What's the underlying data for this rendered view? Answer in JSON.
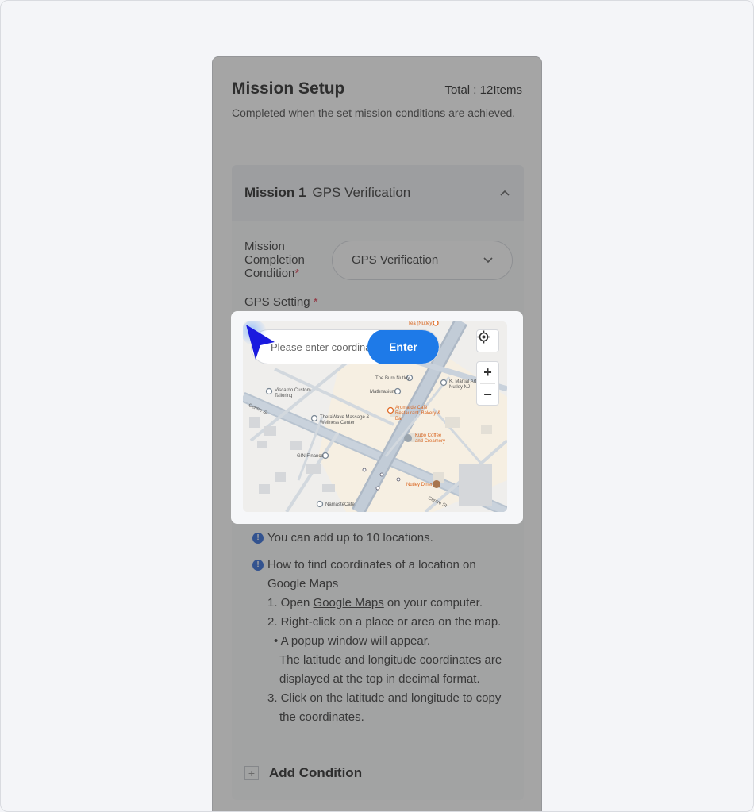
{
  "header": {
    "title": "Mission Setup",
    "total": "Total : 12Items",
    "subtitle": "Completed when the set mission conditions are achieved."
  },
  "mission": {
    "number": "Mission 1",
    "name": "GPS Verification",
    "condition_label": "Mission Completion Condition",
    "required_mark": "*",
    "condition_value": "GPS Verification",
    "gps_label": "GPS Setting"
  },
  "map": {
    "search_placeholder": "Please enter coordinates",
    "enter_label": "Enter",
    "zoom_in": "+",
    "zoom_out": "−",
    "places": {
      "tea": "Tea (Nutley)",
      "burn": "The Burn Nutley",
      "martial": "K. Martial Arts Nutley NJ",
      "mathnasium": "Mathnasium",
      "viscardo": "Viscardo Custom Tailoring",
      "aroma": "Aroma de Café Restaurant, Bakery & Bar",
      "therawave": "TheraWave Massage & Wellness Center",
      "kubo": "Kubo Coffee and Creamery",
      "gin": "GIN Finance",
      "nutley_diner": "Nutley Diner",
      "namaste": "NamasteCafe",
      "centre_st": "Centre St"
    }
  },
  "notes": {
    "limit": "You can add up to 10 locations.",
    "howto": "How to find coordinates of a location on Google Maps",
    "step1_prefix": "1. Open ",
    "step1_link": "Google Maps",
    "step1_suffix": " on your computer.",
    "step2": "2. Right-click on a place or area on the map.",
    "step2_bullet": "• A popup window will appear.",
    "step2_detail_a": "The latitude and longitude coordinates are",
    "step2_detail_b": "displayed at the top in decimal format.",
    "step3_a": "3. Click on the latitude and longitude to copy",
    "step3_b": "the coordinates."
  },
  "add_condition": "Add Condition",
  "colors": {
    "accent": "#1e7ae8",
    "cursor": "#1a1adf",
    "required": "#e0455a",
    "info": "#3b72d9"
  }
}
